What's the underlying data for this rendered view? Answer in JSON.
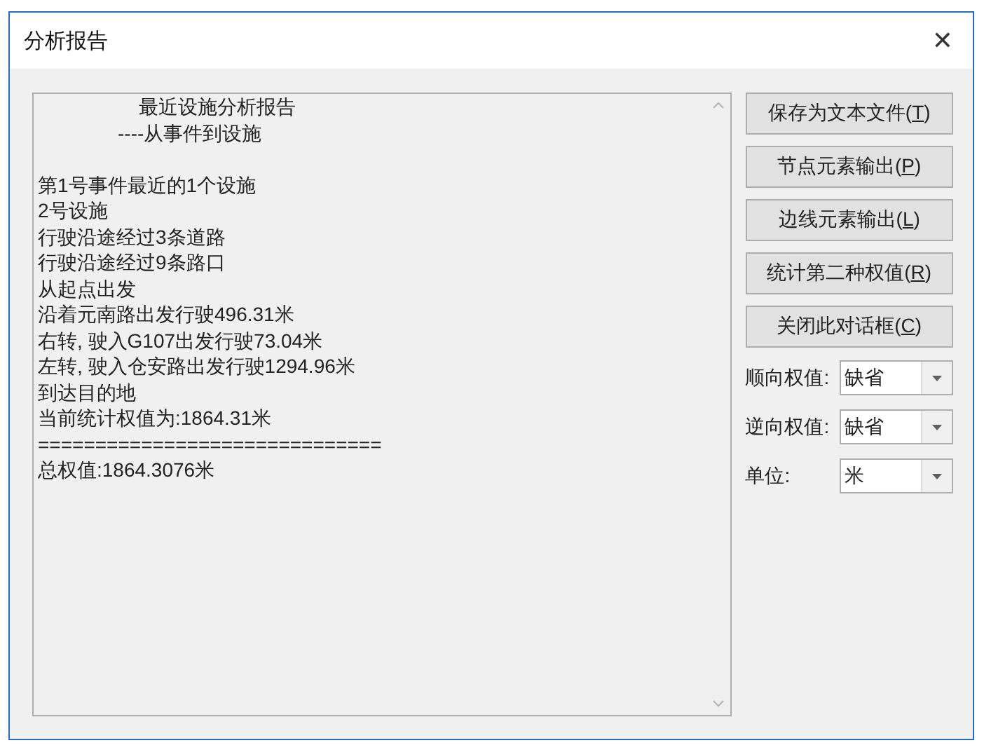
{
  "window": {
    "title": "分析报告",
    "close": "✕"
  },
  "report": {
    "lines": [
      {
        "kind": "title",
        "text": "最近设施分析报告"
      },
      {
        "kind": "subtitle",
        "text": "----从事件到设施"
      },
      {
        "kind": "gap"
      },
      {
        "kind": "line",
        "text": "第1号事件最近的1个设施"
      },
      {
        "kind": "line",
        "text": "2号设施"
      },
      {
        "kind": "line",
        "text": "行驶沿途经过3条道路"
      },
      {
        "kind": "line",
        "text": "行驶沿途经过9条路口"
      },
      {
        "kind": "line",
        "text": "从起点出发"
      },
      {
        "kind": "line",
        "text": "沿着元南路出发行驶496.31米"
      },
      {
        "kind": "line",
        "text": "右转, 驶入G107出发行驶73.04米"
      },
      {
        "kind": "line",
        "text": "左转, 驶入仓安路出发行驶1294.96米"
      },
      {
        "kind": "line",
        "text": "到达目的地"
      },
      {
        "kind": "line",
        "text": "当前统计权值为:1864.31米"
      },
      {
        "kind": "line",
        "text": "=============================="
      },
      {
        "kind": "line",
        "text": "总权值:1864.3076米"
      }
    ]
  },
  "buttons": [
    {
      "before": "保存为文本文件(",
      "key": "T",
      "after": ")"
    },
    {
      "before": "节点元素输出(",
      "key": "P",
      "after": ")"
    },
    {
      "before": "边线元素输出(",
      "key": "L",
      "after": ")"
    },
    {
      "before": "统计第二种权值(",
      "key": "R",
      "after": ")"
    },
    {
      "before": "关闭此对话框(",
      "key": "C",
      "after": ")"
    }
  ],
  "fields": [
    {
      "label": "顺向权值:",
      "value": "缺省"
    },
    {
      "label": "逆向权值:",
      "value": "缺省"
    },
    {
      "label": "单位:",
      "value": "米"
    }
  ]
}
